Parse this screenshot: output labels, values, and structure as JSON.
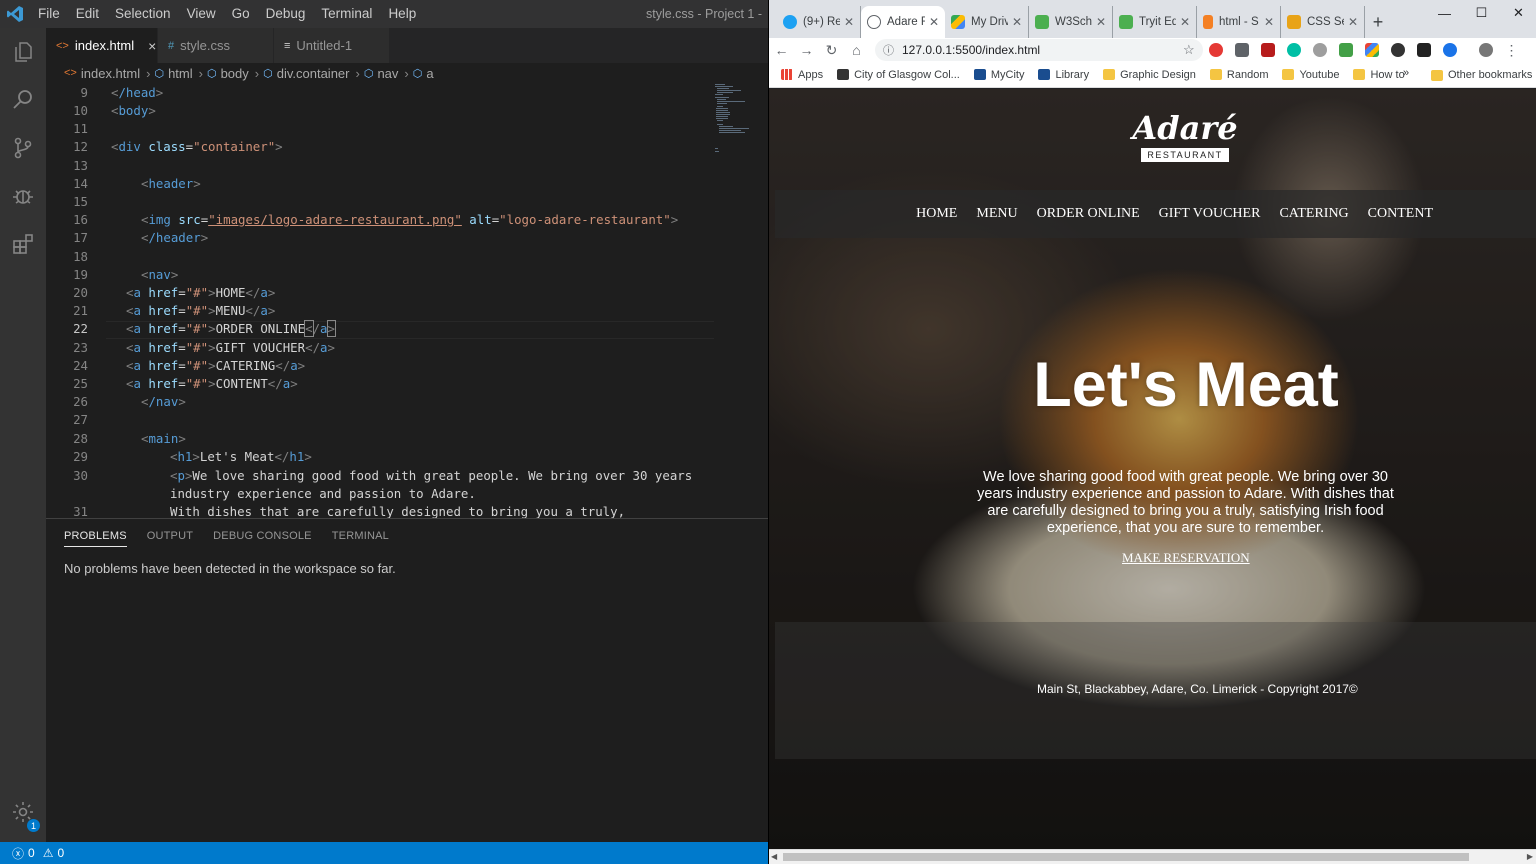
{
  "vscode": {
    "menu": [
      "File",
      "Edit",
      "Selection",
      "View",
      "Go",
      "Debug",
      "Terminal",
      "Help"
    ],
    "window_title": "style.css - Project 1 -",
    "tabs": [
      {
        "label": "index.html",
        "icon": "<>",
        "active": true
      },
      {
        "label": "style.css",
        "icon": "#",
        "active": false
      },
      {
        "label": "Untitled-1",
        "icon": "≡",
        "active": false
      }
    ],
    "breadcrumbs": [
      "index.html",
      "html",
      "body",
      "div.container",
      "nav",
      "a"
    ],
    "lines": [
      {
        "n": "9"
      },
      {
        "n": "10"
      },
      {
        "n": "11"
      },
      {
        "n": "12"
      },
      {
        "n": "13"
      },
      {
        "n": "14"
      },
      {
        "n": "15"
      },
      {
        "n": "16"
      },
      {
        "n": "17"
      },
      {
        "n": "18"
      },
      {
        "n": "19"
      },
      {
        "n": "20"
      },
      {
        "n": "21"
      },
      {
        "n": "22"
      },
      {
        "n": "23"
      },
      {
        "n": "24"
      },
      {
        "n": "25"
      },
      {
        "n": "26"
      },
      {
        "n": "27"
      },
      {
        "n": "28"
      },
      {
        "n": "29"
      },
      {
        "n": "30"
      },
      {
        "n": ""
      },
      {
        "n": "31"
      }
    ],
    "code": {
      "l9_tag": "/head",
      "l10_tag": "body",
      "l12_tag": "div",
      "l12_attr": "class",
      "l12_val": "\"container\"",
      "l14_tag": "header",
      "l16_tag": "img",
      "l16_a1": "src",
      "l16_v1": "\"images/logo-adare-restaurant.png\"",
      "l16_a2": "alt",
      "l16_v2": "\"logo-adare-restaurant\"",
      "l17_tag": "/header",
      "l19_tag": "nav",
      "nav_links": [
        "HOME",
        "MENU",
        "ORDER ONLINE",
        "GIFT VOUCHER",
        "CATERING",
        "CONTENT"
      ],
      "href_attr": "href",
      "href_val": "\"#\"",
      "l26_tag": "/nav",
      "l28_tag": "main",
      "l29_text": "Let's Meat",
      "l30_text": "We love sharing good food with great people. We bring over 30 years",
      "l30b_text": "industry experience and passion to Adare.",
      "l31_text": "With dishes that are carefully designed to bring you a truly,"
    },
    "panel": {
      "tabs": [
        "PROBLEMS",
        "OUTPUT",
        "DEBUG CONSOLE",
        "TERMINAL"
      ],
      "message": "No problems have been detected in the workspace so far."
    },
    "status": {
      "errors": "0",
      "warnings": "0"
    },
    "settings_badge": "1"
  },
  "chrome": {
    "tabs": [
      {
        "label": "(9+) Re",
        "fav": "#1da1f2"
      },
      {
        "label": "Adare R",
        "fav": "#5f6368",
        "active": true
      },
      {
        "label": "My Driv",
        "fav": "#34a853"
      },
      {
        "label": "W3Scho",
        "fav": "#4caf50"
      },
      {
        "label": "Tryit Ed",
        "fav": "#4caf50"
      },
      {
        "label": "html - S",
        "fav": "#f48024"
      },
      {
        "label": "CSS Sel",
        "fav": "#e44d26"
      }
    ],
    "url": "127.0.0.1:5500/index.html",
    "bookmarks": [
      {
        "label": "Apps",
        "color": "#ea4335"
      },
      {
        "label": "City of Glasgow Col...",
        "color": "#333"
      },
      {
        "label": "MyCity",
        "color": "#1a4d8f"
      },
      {
        "label": "Library",
        "color": "#1a4d8f"
      },
      {
        "label": "Graphic Design",
        "color": "#f4c542"
      },
      {
        "label": "Random",
        "color": "#f4c542"
      },
      {
        "label": "Youtube",
        "color": "#f4c542"
      },
      {
        "label": "How to",
        "color": "#f4c542"
      }
    ],
    "bookmarks_more": "»",
    "other_bookmarks": "Other bookmarks",
    "extensions": [
      "#e53935",
      "#5f6368",
      "#b71c1c",
      "#00bfa5",
      "#9e9e9e",
      "#43a047",
      "#4285f4",
      "#333",
      "#222",
      "#1a73e8"
    ]
  },
  "site": {
    "logo_name": "Adaré",
    "logo_sub": "RESTAURANT",
    "nav": [
      "HOME",
      "MENU",
      "ORDER ONLINE",
      "GIFT VOUCHER",
      "CATERING",
      "CONTENT"
    ],
    "heading": "Let's Meat",
    "paragraph": "We love sharing good food with great people. We bring over 30 years industry experience and passion to Adare. With dishes that are carefully designed to bring you a truly, satisfying Irish food experience, that you are sure to remember.",
    "button": "MAKE RESERVATION",
    "footer": "Main St, Blackabbey, Adare, Co. Limerick - Copyright 2017©"
  }
}
